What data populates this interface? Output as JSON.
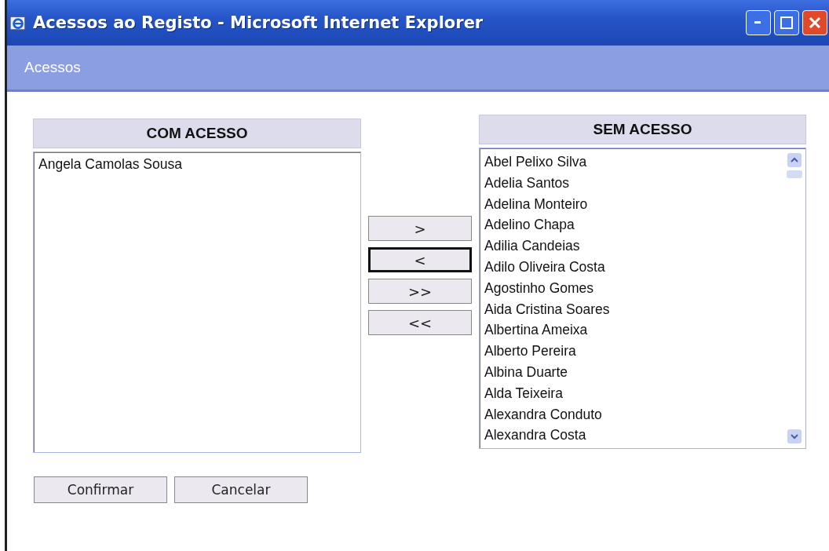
{
  "window": {
    "title": "Acessos ao Registo - Microsoft Internet Explorer"
  },
  "page_header": {
    "title": "Acessos"
  },
  "with_access": {
    "heading": "COM ACESSO",
    "items": [
      "Angela Camolas Sousa"
    ]
  },
  "transfer_buttons": [
    {
      "label": ">",
      "focused": false
    },
    {
      "label": "<",
      "focused": true
    },
    {
      "label": ">>",
      "focused": false
    },
    {
      "label": "<<",
      "focused": false
    }
  ],
  "without_access": {
    "heading": "SEM ACESSO",
    "items": [
      "Abel Pelixo Silva",
      "Adelia Santos",
      "Adelina Monteiro",
      "Adelino Chapa",
      "Adilia Candeias",
      "Adilo Oliveira Costa",
      "Agostinho Gomes",
      "Aida Cristina Soares",
      "Albertina Ameixa",
      "Alberto Pereira",
      "Albina Duarte",
      "Alda Teixeira",
      "Alexandra Conduto",
      "Alexandra Costa"
    ]
  },
  "actions": [
    "Confirmar",
    "Cancelar"
  ]
}
